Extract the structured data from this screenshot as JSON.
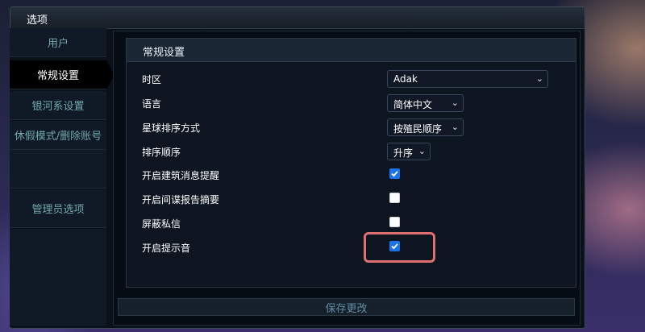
{
  "window": {
    "title": "选项"
  },
  "sidebar": {
    "items": [
      {
        "label": "用户",
        "active": false
      },
      {
        "label": "常规设置",
        "active": true
      },
      {
        "label": "银河系设置",
        "active": false
      },
      {
        "label": "休假模式/删除账号",
        "active": false
      },
      {
        "label": "管理员选项",
        "active": false
      }
    ]
  },
  "panel": {
    "title": "常规设置"
  },
  "settings": {
    "timezone": {
      "label": "时区",
      "value": "Adak"
    },
    "language": {
      "label": "语言",
      "value": "简体中文"
    },
    "planet_sort": {
      "label": "星球排序方式",
      "value": "按殖民顺序"
    },
    "sort_order": {
      "label": "排序顺序",
      "value": "升序"
    },
    "building_notify": {
      "label": "开启建筑消息提醒",
      "checked": true
    },
    "spy_report_summary": {
      "label": "开启间谍报告摘要",
      "checked": false
    },
    "block_pm": {
      "label": "屏蔽私信",
      "checked": false
    },
    "sound_alert": {
      "label": "开启提示音",
      "checked": true
    }
  },
  "save_button": {
    "label": "保存更改"
  },
  "icons": {
    "chevron": "chevron-down-icon",
    "check": "checkmark-icon"
  },
  "colors": {
    "checkbox_on": "#1a73e8",
    "highlight": "#e07070",
    "nav_text": "#6fa8ad"
  }
}
